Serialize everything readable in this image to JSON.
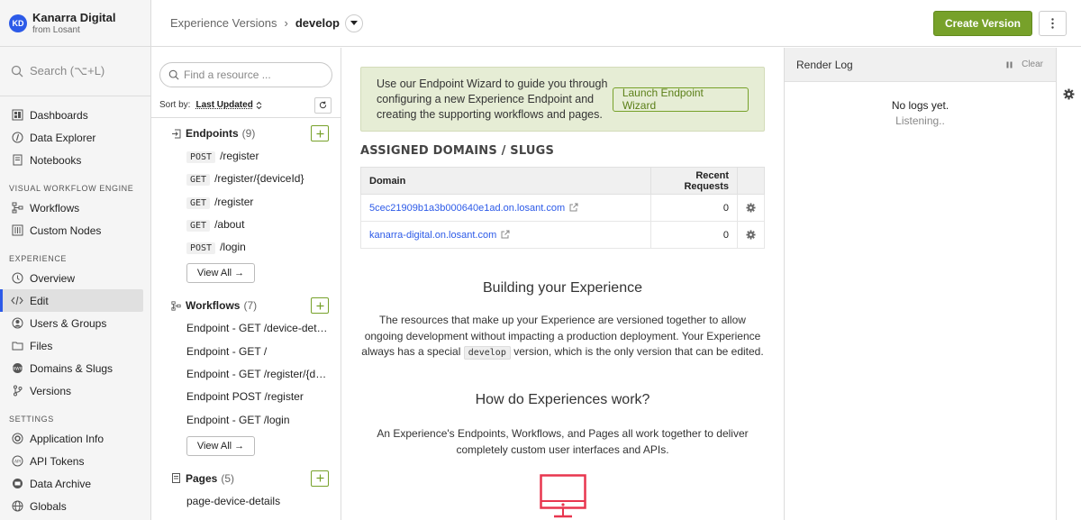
{
  "org": {
    "initials": "KD",
    "name": "Kanarra Digital",
    "sub": "from Losant",
    "avatar_color": "#2c5ae8"
  },
  "sidebar": {
    "search_placeholder": "Search (⌥+L)",
    "sections": [
      {
        "title": "",
        "items": [
          {
            "label": "Dashboards",
            "icon": "dashboard-icon"
          },
          {
            "label": "Data Explorer",
            "icon": "data-explorer-icon"
          },
          {
            "label": "Notebooks",
            "icon": "notebook-icon"
          }
        ]
      },
      {
        "title": "VISUAL WORKFLOW ENGINE",
        "items": [
          {
            "label": "Workflows",
            "icon": "workflow-icon"
          },
          {
            "label": "Custom Nodes",
            "icon": "custom-nodes-icon"
          }
        ]
      },
      {
        "title": "EXPERIENCE",
        "items": [
          {
            "label": "Overview",
            "icon": "overview-icon"
          },
          {
            "label": "Edit",
            "icon": "code-icon",
            "active": true
          },
          {
            "label": "Users & Groups",
            "icon": "users-icon"
          },
          {
            "label": "Files",
            "icon": "folder-icon"
          },
          {
            "label": "Domains & Slugs",
            "icon": "www-icon"
          },
          {
            "label": "Versions",
            "icon": "branch-icon"
          }
        ]
      },
      {
        "title": "SETTINGS",
        "items": [
          {
            "label": "Application Info",
            "icon": "gear-icon"
          },
          {
            "label": "API Tokens",
            "icon": "api-icon"
          },
          {
            "label": "Data Archive",
            "icon": "archive-icon"
          },
          {
            "label": "Globals",
            "icon": "globe-icon"
          }
        ]
      }
    ]
  },
  "topbar": {
    "breadcrumb_root": "Experience Versions",
    "breadcrumb_sep": "›",
    "breadcrumb_current": "develop",
    "create_label": "Create Version",
    "accent": "#77a12a"
  },
  "resources": {
    "search_placeholder": "Find a resource ...",
    "sort_label": "Sort by:",
    "sort_value": "Last Updated",
    "endpoints": {
      "title": "Endpoints",
      "count": "(9)",
      "items": [
        {
          "method": "POST",
          "path": "/register"
        },
        {
          "method": "GET",
          "path": "/register/{deviceId}"
        },
        {
          "method": "GET",
          "path": "/register"
        },
        {
          "method": "GET",
          "path": "/about"
        },
        {
          "method": "POST",
          "path": "/login"
        }
      ],
      "view_all": "View All →"
    },
    "workflows": {
      "title": "Workflows",
      "count": "(7)",
      "items": [
        "Endpoint - GET /device-details",
        "Endpoint - GET /",
        "Endpoint - GET /register/{deviceId}",
        "Endpoint POST /register",
        "Endpoint - GET /login"
      ],
      "view_all": "View All →"
    },
    "pages": {
      "title": "Pages",
      "count": "(5)",
      "items": [
        "page-device-details"
      ]
    }
  },
  "main": {
    "wizard_text": "Use our Endpoint Wizard to guide you through configuring a new Experience Endpoint and creating the supporting workflows and pages.",
    "wizard_button": "Launch Endpoint Wizard",
    "domains_title": "ASSIGNED DOMAINS / SLUGS",
    "domains_headers": {
      "domain": "Domain",
      "requests": "Recent Requests"
    },
    "domains": [
      {
        "domain": "5cec21909b1a3b000640e1ad.on.losant.com",
        "requests": "0"
      },
      {
        "domain": "kanarra-digital.on.losant.com",
        "requests": "0"
      }
    ],
    "build_title": "Building your Experience",
    "build_para_1": "The resources that make up your Experience are versioned together to allow ongoing development without impacting a production deployment. Your Experience always has a special",
    "build_chip": "develop",
    "build_para_2": "version, which is the only version that can be edited.",
    "how_title": "How do Experiences work?",
    "how_para": "An Experience's Endpoints, Workflows, and Pages all work together to deliver completely custom user interfaces and APIs.",
    "illustration_color": "#e8364f"
  },
  "log": {
    "title": "Render Log",
    "clear": "Clear",
    "empty_1": "No logs yet.",
    "empty_2": "Listening.."
  }
}
